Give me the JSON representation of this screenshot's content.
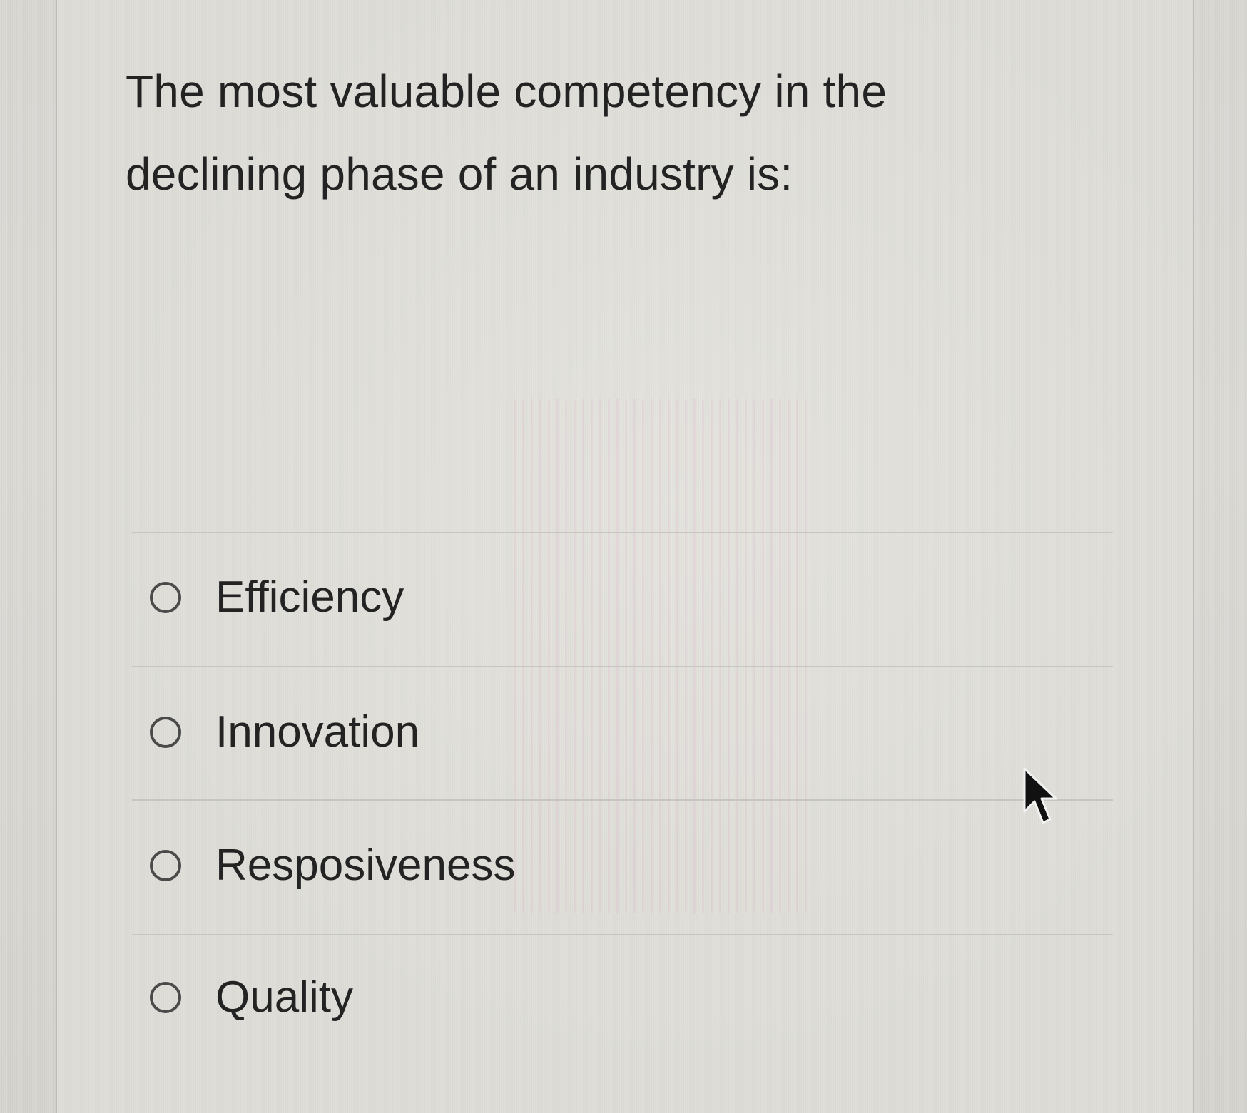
{
  "question": {
    "text": "The most valuable competency in the declining phase of an industry is:"
  },
  "options": [
    {
      "label": "Efficiency"
    },
    {
      "label": "Innovation"
    },
    {
      "label": "Resposiveness"
    },
    {
      "label": "Quality"
    }
  ],
  "icons": {
    "radio": "radio-button-icon",
    "cursor": "mouse-pointer-icon"
  },
  "colors": {
    "text": "#232323",
    "radio_border": "#4a4a4a",
    "background": "#dddcd6",
    "divider": "#c6c5bf"
  }
}
